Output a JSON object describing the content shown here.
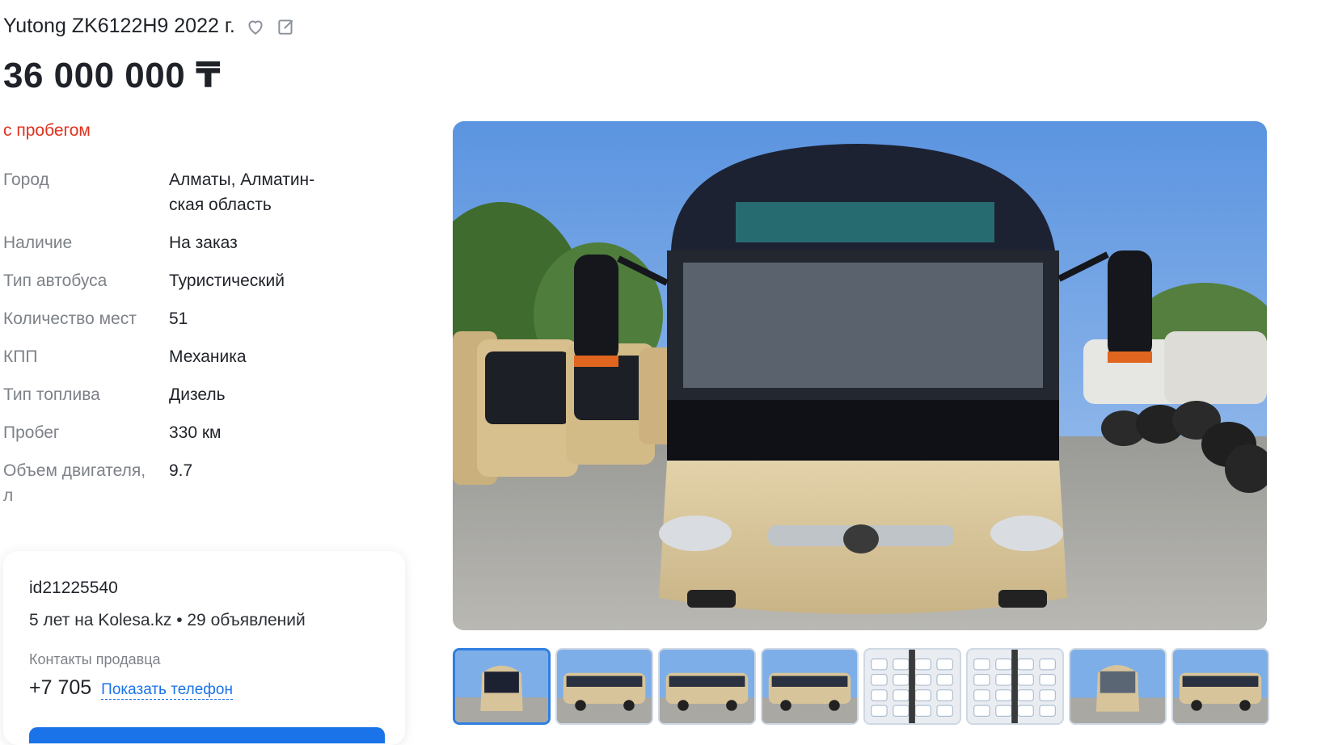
{
  "listing": {
    "title": "Yutong ZK6122H9 2022 г.",
    "price": "36 000 000 ₸",
    "condition": "с пробегом",
    "icons": {
      "favorite": "heart-icon",
      "note": "edit-note-icon"
    }
  },
  "specs": [
    {
      "label": "Город",
      "value": "Алматы, Алматин-\nская область"
    },
    {
      "label": "Наличие",
      "value": "На заказ"
    },
    {
      "label": "Тип автобуса",
      "value": "Туристический"
    },
    {
      "label": "Количество мест",
      "value": "51"
    },
    {
      "label": "КПП",
      "value": "Механика"
    },
    {
      "label": "Тип топлива",
      "value": "Дизель"
    },
    {
      "label": "Пробег",
      "value": "330 км"
    },
    {
      "label": "Объем двигателя,\nл",
      "value": "9.7"
    }
  ],
  "seller": {
    "id": "id21225540",
    "meta": "5 лет на Kolesa.kz • 29 объявлений",
    "contacts_label": "Контакты продавца",
    "phone": "+7 705",
    "show_phone": "Показать телефон"
  },
  "gallery": {
    "thumbnail_count": 8,
    "active_index": 0,
    "colors": {
      "sky": "#6fa4e6",
      "bus_body": "#d8c49a",
      "bus_top": "#1d2233",
      "active_border": "#2f7fe0"
    }
  }
}
